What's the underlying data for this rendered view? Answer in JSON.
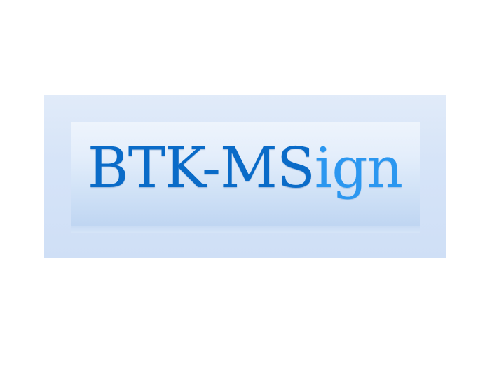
{
  "logo": {
    "text_main": "BTK-MS",
    "text_accent": "ign",
    "colors": {
      "main": "#0a6bc8",
      "accent": "#2b97f0",
      "panel": "#d6e4f8"
    }
  }
}
